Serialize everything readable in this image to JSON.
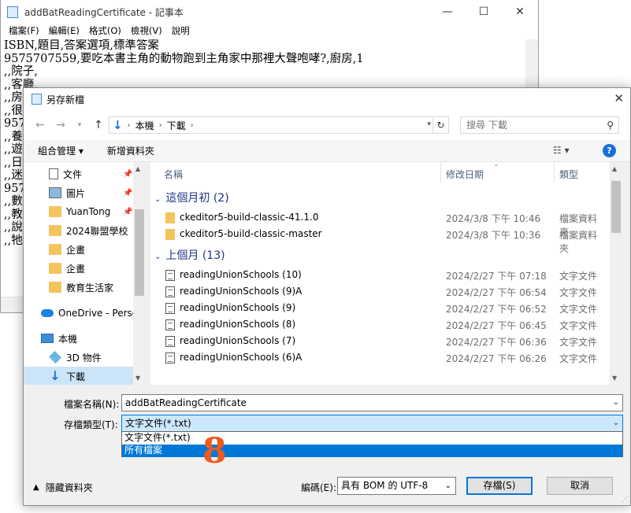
{
  "notepad": {
    "title": "addBatReadingCertificate - 記事本",
    "menu": [
      "檔案(F)",
      "編輯(E)",
      "格式(O)",
      "檢視(V)",
      "說明"
    ],
    "lines": [
      "ISBN,題目,答案選項,標準答案",
      "9575707559,要吃本書主角的動物跑到主角家中那裡大聲咆哮?,廚房,1",
      ",,院子,",
      ",,客廳,",
      ",,房",
      ",,很",
      "957",
      ",,養",
      ",,遊",
      ",,日",
      ",,迷",
      "957",
      ",,數",
      ",,教",
      ",,說",
      ",,牠"
    ]
  },
  "dialog": {
    "title": "另存新檔",
    "close": "✕",
    "address": {
      "root": "本機",
      "current": "下載"
    },
    "search_placeholder": "搜尋 下載",
    "toolbar": {
      "organize": "組合管理 ▾",
      "new_folder": "新增資料夾"
    },
    "help": "?",
    "nav_items": [
      {
        "label": "文件",
        "icon": "document-icon",
        "pinned": true
      },
      {
        "label": "圖片",
        "icon": "picture-icon",
        "pinned": true
      },
      {
        "label": "YuanTong",
        "icon": "folder-icon",
        "pinned": true
      },
      {
        "label": "2024聯盟學校「",
        "icon": "folder-icon",
        "pinned": false
      },
      {
        "label": "企畫",
        "icon": "folder-icon",
        "pinned": false
      },
      {
        "label": "企畫",
        "icon": "folder-icon",
        "pinned": false
      },
      {
        "label": "教育生活家",
        "icon": "folder-icon",
        "pinned": false
      },
      {
        "label": "OneDrive - Perso",
        "icon": "cloud-icon",
        "pinned": false
      },
      {
        "label": "本機",
        "icon": "computer-icon",
        "pinned": false
      },
      {
        "label": "3D 物件",
        "icon": "cube-icon",
        "pinned": false
      },
      {
        "label": "下載",
        "icon": "download-icon",
        "pinned": false,
        "selected": true
      }
    ],
    "columns": {
      "name": "名稱",
      "date": "修改日期",
      "type": "類型"
    },
    "groups": [
      {
        "title": "這個月初 (2)",
        "files": [
          {
            "name": "ckeditor5-build-classic-41.1.0",
            "date": "2024/3/8 下午 10:46",
            "type": "檔案資料夾",
            "kind": "folder"
          },
          {
            "name": "ckeditor5-build-classic-master",
            "date": "2024/3/8 下午 10:36",
            "type": "檔案資料夾",
            "kind": "folder"
          }
        ]
      },
      {
        "title": "上個月 (13)",
        "files": [
          {
            "name": "readingUnionSchools (10)",
            "date": "2024/2/27 下午 07:18",
            "type": "文字文件",
            "kind": "txt"
          },
          {
            "name": "readingUnionSchools (9)A",
            "date": "2024/2/27 下午 06:54",
            "type": "文字文件",
            "kind": "txt"
          },
          {
            "name": "readingUnionSchools (9)",
            "date": "2024/2/27 下午 06:52",
            "type": "文字文件",
            "kind": "txt"
          },
          {
            "name": "readingUnionSchools (8)",
            "date": "2024/2/27 下午 06:45",
            "type": "文字文件",
            "kind": "txt"
          },
          {
            "name": "readingUnionSchools (7)",
            "date": "2024/2/27 下午 06:36",
            "type": "文字文件",
            "kind": "txt"
          },
          {
            "name": "readingUnionSchools (6)A",
            "date": "2024/2/27 下午 06:26",
            "type": "文字文件",
            "kind": "txt"
          }
        ]
      }
    ],
    "filename_label": "檔案名稱(N):",
    "filename_value": "addBatReadingCertificate",
    "filetype_label": "存檔類型(T):",
    "filetype_value": "文字文件(*.txt)",
    "filetype_options": [
      "文字文件(*.txt)",
      "所有檔案"
    ],
    "annotation": "8",
    "hide_folders": "隱藏資料夾",
    "encoding_label": "編碼(E):",
    "encoding_value": "具有 BOM 的 UTF-8",
    "save": "存檔(S)",
    "cancel": "取消"
  },
  "colors": {
    "accent": "#0078d7",
    "selection": "#cce4f7",
    "annotation": "#f05a1e"
  }
}
